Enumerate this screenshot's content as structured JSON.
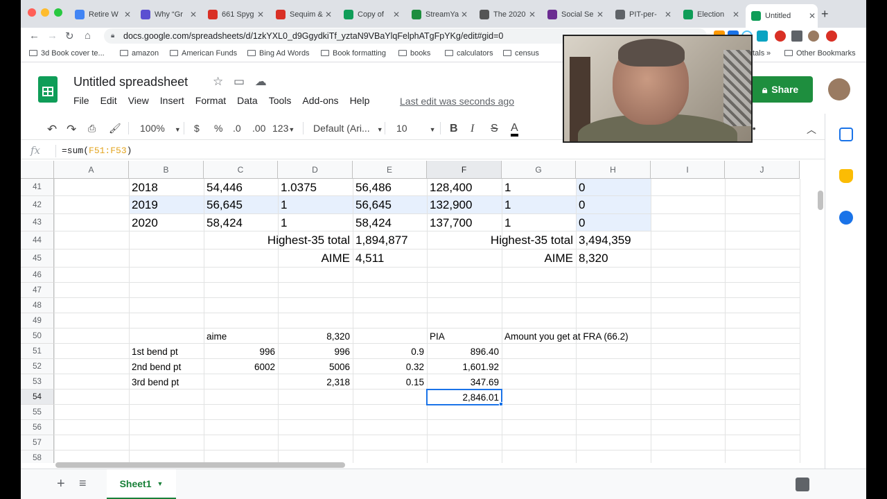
{
  "browser": {
    "tabs": [
      {
        "title": "Retire W",
        "icon": "docs-icon",
        "color": "#4285f4"
      },
      {
        "title": "Why “Gr",
        "icon": "video-icon",
        "color": "#5b4fd1"
      },
      {
        "title": "661 Spyg",
        "icon": "house-icon",
        "color": "#d93025"
      },
      {
        "title": "Sequim &",
        "icon": "house-icon",
        "color": "#d93025"
      },
      {
        "title": "Copy of",
        "icon": "sheets-icon",
        "color": "#0f9d58"
      },
      {
        "title": "StreamYa",
        "icon": "stream-icon",
        "color": "#1e8e3e"
      },
      {
        "title": "The 2020",
        "icon": "page-icon",
        "color": "#555555"
      },
      {
        "title": "Social Se",
        "icon": "ssa-icon",
        "color": "#6b2c91"
      },
      {
        "title": "PIT-per-",
        "icon": "globe-icon",
        "color": "#5f6368"
      },
      {
        "title": "Election",
        "icon": "sheets-icon",
        "color": "#0f9d58"
      },
      {
        "title": "Untitled",
        "icon": "sheets-icon",
        "color": "#0f9d58",
        "active": true
      }
    ],
    "url": "docs.google.com/spreadsheets/d/1zkYXL0_d9GgydkiTf_yztaN9VBaYlqFelphATgFpYKg/edit#gid=0",
    "bookmarks": [
      "3d Book cover te...",
      "amazon",
      "American Funds",
      "Bing Ad Words",
      "Book formatting",
      "books",
      "calculators",
      "census"
    ],
    "bookmarks_right": [
      "otals",
      "»",
      "Other Bookmarks"
    ]
  },
  "doc": {
    "title": "Untitled spreadsheet",
    "menus": [
      "File",
      "Edit",
      "View",
      "Insert",
      "Format",
      "Data",
      "Tools",
      "Add-ons",
      "Help"
    ],
    "last_edit": "Last edit was seconds ago",
    "share_label": "Share"
  },
  "toolbar": {
    "zoom": "100%",
    "currency": "$",
    "percent": "%",
    "dec_less": ".0",
    "dec_more": ".00",
    "more_formats": "123",
    "font": "Default (Ari...",
    "font_size": "10",
    "bold": "B",
    "italic": "I",
    "strike": "S",
    "text_color": "A",
    "more": "•••"
  },
  "formula_bar": {
    "fx": "fx",
    "prefix": "=sum(",
    "ref": "F51:F53",
    "suffix": ")"
  },
  "columns": [
    "A",
    "B",
    "C",
    "D",
    "E",
    "F",
    "G",
    "H",
    "I",
    "J"
  ],
  "rows": [
    "41",
    "42",
    "43",
    "44",
    "45",
    "46",
    "47",
    "48",
    "49",
    "50",
    "51",
    "52",
    "53",
    "54",
    "55",
    "56",
    "57",
    "58"
  ],
  "cells": {
    "r41": {
      "b": "2018",
      "c": "54,446",
      "d": "1.0375",
      "e": "56,486",
      "f": "128,400",
      "g": "1",
      "h": "0"
    },
    "r42": {
      "b": "2019",
      "c": "56,645",
      "d": "1",
      "e": "56,645",
      "f": "132,900",
      "g": "1",
      "h": "0"
    },
    "r43": {
      "b": "2020",
      "c": "58,424",
      "d": "1",
      "e": "58,424",
      "f": "137,700",
      "g": "1",
      "h": "0"
    },
    "r44": {
      "label1": "Highest-35 total",
      "val1": "1,894,877",
      "label2": "Highest-35 total",
      "val2": "3,494,359"
    },
    "r45": {
      "label1": "AIME",
      "val1": "4,511",
      "label2": "AIME",
      "val2": "8,320"
    },
    "r50": {
      "c": "aime",
      "d": "8,320",
      "f": "PIA",
      "g": "Amount you get at FRA (66.2)"
    },
    "r51": {
      "b": "1st bend pt",
      "c": "996",
      "d": "996",
      "e": "0.9",
      "f": "896.40"
    },
    "r52": {
      "b": "2nd bend pt",
      "c": "6002",
      "d": "5006",
      "e": "0.32",
      "f": "1,601.92"
    },
    "r53": {
      "b": "3rd bend pt",
      "d": "2,318",
      "e": "0.15",
      "f": "347.69"
    },
    "r54": {
      "f": "2,846.01"
    }
  },
  "sheets": {
    "active": "Sheet1"
  }
}
